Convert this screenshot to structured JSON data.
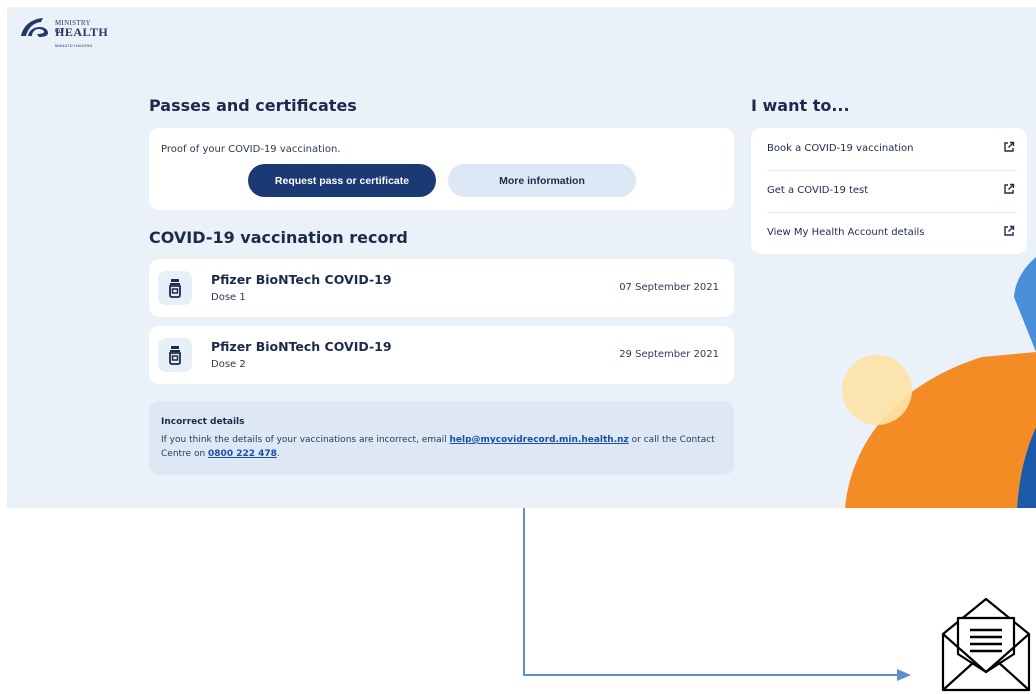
{
  "logo": {
    "line1": "MINISTRY OF",
    "line2": "HEALTH",
    "line3": "MANATŪ HAUORA",
    "icon": "ministry-logo-mark"
  },
  "passes": {
    "heading": "Passes and certificates",
    "proof_text": "Proof of your COVID-19 vaccination.",
    "primary_button": "Request pass or certificate",
    "secondary_button": "More information"
  },
  "record": {
    "heading": "COVID-19 vaccination record",
    "items": [
      {
        "name": "Pfizer BioNTech COVID-19",
        "dose": "Dose 1",
        "date": "07 September 2021",
        "icon": "vaccine-vial-icon"
      },
      {
        "name": "Pfizer BioNTech COVID-19",
        "dose": "Dose 2",
        "date": "29 September 2021",
        "icon": "vaccine-vial-icon"
      }
    ]
  },
  "incorrect": {
    "title": "Incorrect details",
    "text_before": "If you think the details of your vaccinations are incorrect, email ",
    "email": "help@mycovidrecord.min.health.nz",
    "text_middle": " or call the Contact Centre on ",
    "phone": "0800 222 478",
    "text_after": "."
  },
  "want": {
    "heading": "I want to...",
    "items": [
      {
        "label": "Book a COVID-19 vaccination",
        "icon": "external-link-icon"
      },
      {
        "label": "Get a COVID-19 test",
        "icon": "external-link-icon"
      },
      {
        "label": "View My Health Account details",
        "icon": "external-link-icon"
      }
    ]
  },
  "colors": {
    "panel_bg": "#eaf1f9",
    "navy": "#1b3a73",
    "light_button": "#dce8f6",
    "link": "#1a4fa8",
    "connector": "#5b8fce",
    "deco_orange": "#f48c25",
    "deco_yellow": "#fde3a7",
    "deco_blue": "#4a90d9",
    "deco_dark_blue": "#1b5aa6"
  },
  "envelope_icon": "envelope-letter-icon"
}
